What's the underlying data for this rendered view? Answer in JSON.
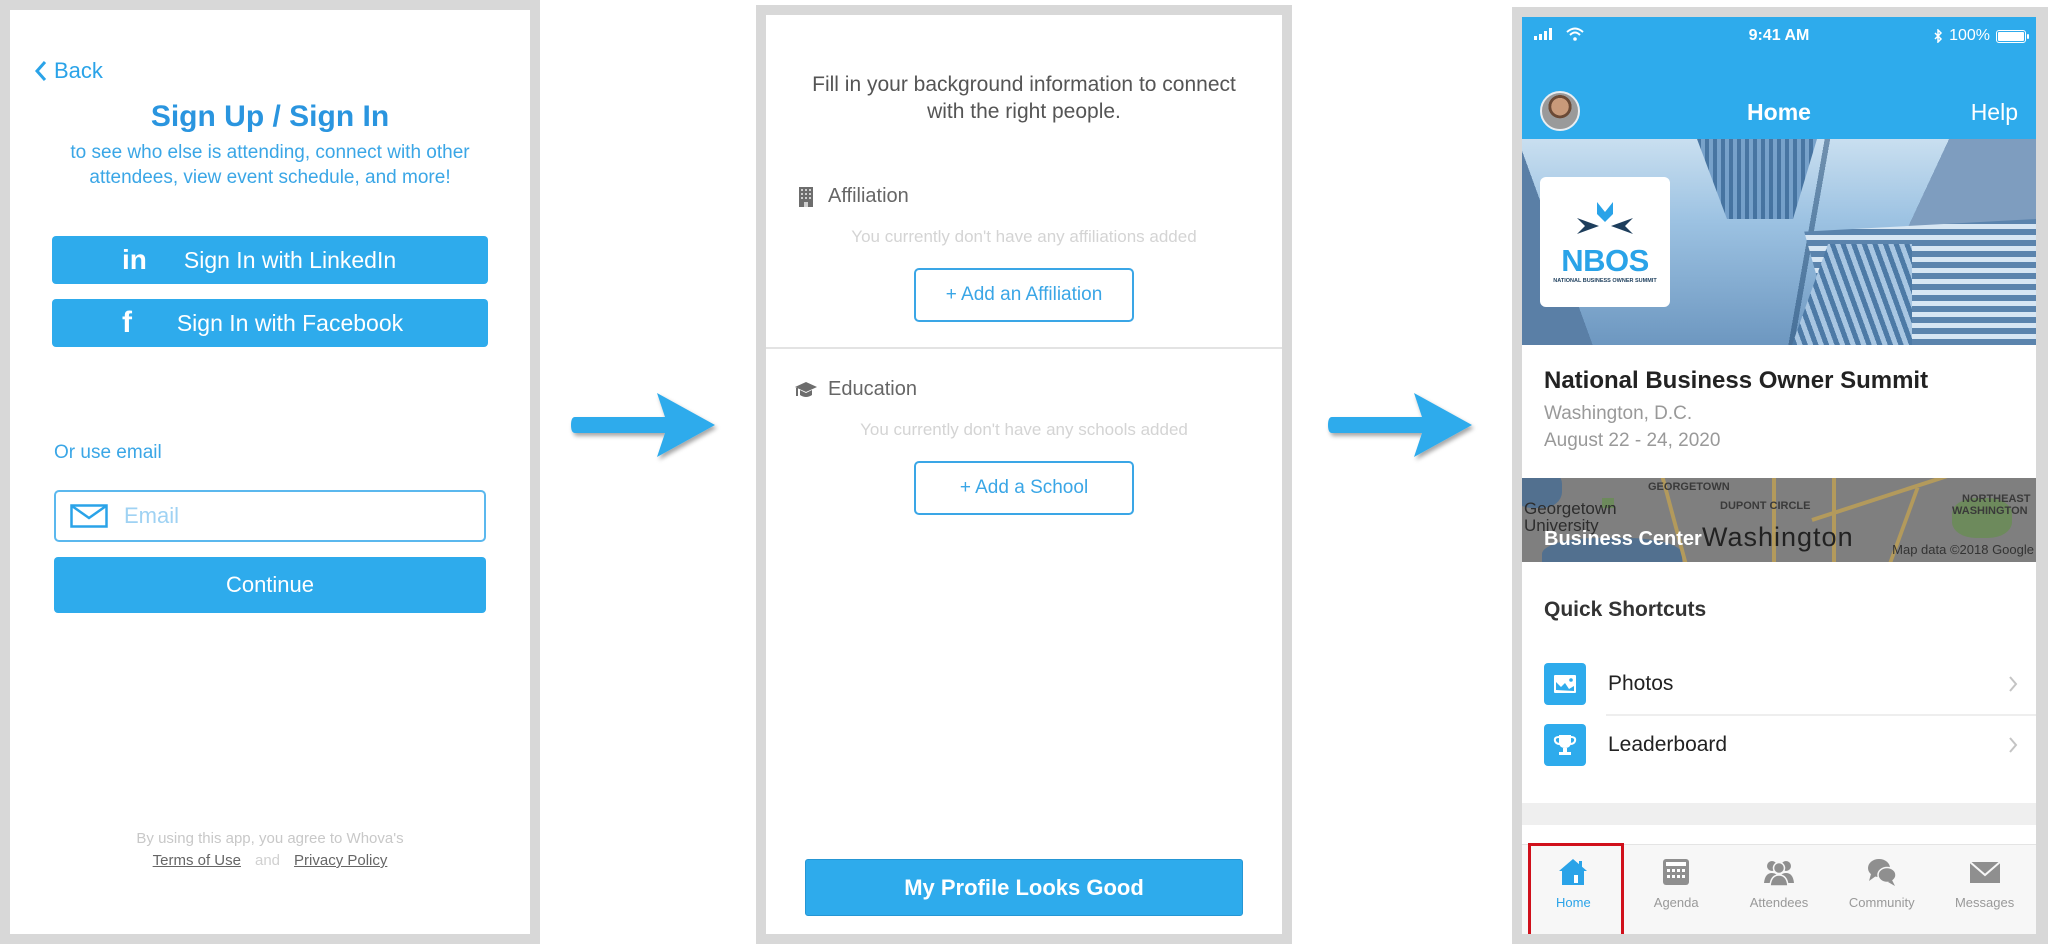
{
  "screens": {
    "signin": {
      "back_label": "Back",
      "title": "Sign Up / Sign In",
      "subtitle": "to see who else is attending, connect with other attendees, view event schedule, and more!",
      "linkedin_button": "Sign In with LinkedIn",
      "linkedin_icon_text": "in",
      "facebook_button": "Sign In with Facebook",
      "facebook_icon_text": "f",
      "or_email_label": "Or use email",
      "email_placeholder": "Email",
      "email_value": "",
      "continue_button": "Continue",
      "legal_text": "By using this app, you agree to Whova's",
      "terms_link": "Terms of Use",
      "and_text": "and",
      "privacy_link": "Privacy Policy"
    },
    "background": {
      "intro": "Fill in your background information to connect with the right people.",
      "affiliation_heading": "Affiliation",
      "affiliation_empty": "You currently don't have any affiliations added",
      "add_affiliation_button": "+ Add an Affiliation",
      "education_heading": "Education",
      "education_empty": "You currently don't have any schools added",
      "add_school_button": "+ Add a School",
      "profile_good_button": "My Profile Looks Good"
    },
    "home": {
      "status_bar": {
        "time": "9:41 AM",
        "battery": "100%"
      },
      "nav_title": "Home",
      "help_label": "Help",
      "logo": {
        "acronym": "NBOS",
        "tagline": "NATIONAL BUSINESS OWNER SUMMIT"
      },
      "event": {
        "title": "National Business Owner Summit",
        "location": "Washington, D.C.",
        "dates": "August 22 - 24, 2020"
      },
      "map": {
        "venue_label": "Business Center",
        "labels": [
          "GEORGETOWN",
          "DUPONT CIRCLE",
          "NORTHEAST",
          "WASHINGTON"
        ],
        "georgetown_univ": "Georgetown University",
        "city_label": "Washington",
        "attribution": "Map data ©2018 Google"
      },
      "quick_shortcuts_title": "Quick Shortcuts",
      "shortcuts": [
        {
          "label": "Photos",
          "icon": "photo-icon"
        },
        {
          "label": "Leaderboard",
          "icon": "trophy-icon"
        }
      ],
      "tabs": [
        {
          "label": "Home",
          "icon": "home-icon",
          "active": true
        },
        {
          "label": "Agenda",
          "icon": "calendar-icon",
          "active": false
        },
        {
          "label": "Attendees",
          "icon": "people-icon",
          "active": false
        },
        {
          "label": "Community",
          "icon": "chat-icon",
          "active": false
        },
        {
          "label": "Messages",
          "icon": "envelope-icon",
          "active": false
        }
      ]
    }
  },
  "colors": {
    "accent": "#2eabec",
    "highlight_box": "#d0101b",
    "frame": "#d8d8d8"
  }
}
